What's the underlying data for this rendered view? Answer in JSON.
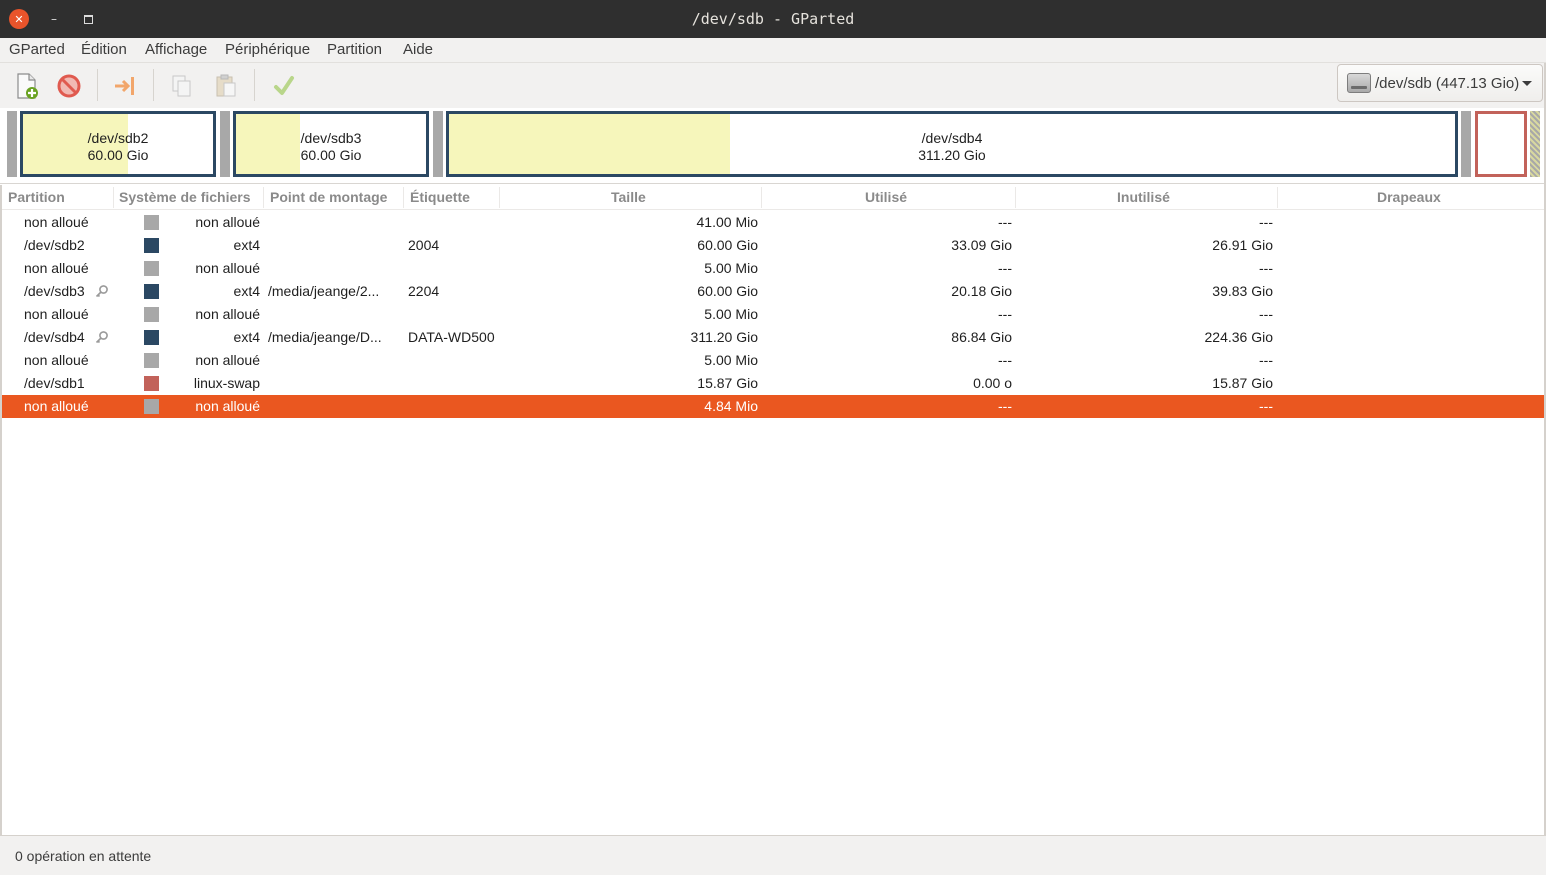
{
  "window": {
    "title": "/dev/sdb - GParted",
    "close_glyph": "✕",
    "minimize_glyph": "–"
  },
  "menu": [
    "GParted",
    "Édition",
    "Affichage",
    "Périphérique",
    "Partition",
    "Aide"
  ],
  "toolbar": {
    "buttons": [
      {
        "name": "new-partition-icon",
        "enabled": true
      },
      {
        "name": "delete-icon",
        "enabled": true
      },
      {
        "name": "resize-move-icon",
        "enabled": true
      },
      {
        "name": "copy-icon",
        "enabled": false
      },
      {
        "name": "paste-icon",
        "enabled": false
      },
      {
        "name": "apply-icon",
        "enabled": false
      }
    ],
    "device_selector": "/dev/sdb (447.13 Gio)"
  },
  "diskmap": {
    "partitions": [
      {
        "name": "/dev/sdb2",
        "size": "60.00 Gio",
        "used_fraction": 0.5515
      },
      {
        "name": "/dev/sdb3",
        "size": "60.00 Gio",
        "used_fraction": 0.3363
      },
      {
        "name": "/dev/sdb4",
        "size": "311.20 Gio",
        "used_fraction": 0.279
      },
      {
        "name": "/dev/sdb1",
        "size": "15.87 Gio",
        "used_fraction": 0.0
      }
    ]
  },
  "table": {
    "columns": [
      "Partition",
      "Système de fichiers",
      "Point de montage",
      "Étiquette",
      "Taille",
      "Utilisé",
      "Inutilisé",
      "Drapeaux"
    ],
    "rows": [
      {
        "partition": "non alloué",
        "fs": "non alloué",
        "fs_color": "#a8a8a8",
        "mount": "",
        "label": "",
        "size": "41.00 Mio",
        "used": "---",
        "unused": "---",
        "flags": "",
        "mounted": false
      },
      {
        "partition": "/dev/sdb2",
        "fs": "ext4",
        "fs_color": "#2b4863",
        "mount": "",
        "label": "2004",
        "size": "60.00 Gio",
        "used": "33.09 Gio",
        "unused": "26.91 Gio",
        "flags": "",
        "mounted": false
      },
      {
        "partition": "non alloué",
        "fs": "non alloué",
        "fs_color": "#a8a8a8",
        "mount": "",
        "label": "",
        "size": "5.00 Mio",
        "used": "---",
        "unused": "---",
        "flags": "",
        "mounted": false
      },
      {
        "partition": "/dev/sdb3",
        "fs": "ext4",
        "fs_color": "#2b4863",
        "mount": "/media/jeange/2...",
        "label": "2204",
        "size": "60.00 Gio",
        "used": "20.18 Gio",
        "unused": "39.83 Gio",
        "flags": "",
        "mounted": true
      },
      {
        "partition": "non alloué",
        "fs": "non alloué",
        "fs_color": "#a8a8a8",
        "mount": "",
        "label": "",
        "size": "5.00 Mio",
        "used": "---",
        "unused": "---",
        "flags": "",
        "mounted": false
      },
      {
        "partition": "/dev/sdb4",
        "fs": "ext4",
        "fs_color": "#2b4863",
        "mount": "/media/jeange/D...",
        "label": "DATA-WD500",
        "size": "311.20 Gio",
        "used": "86.84 Gio",
        "unused": "224.36 Gio",
        "flags": "",
        "mounted": true
      },
      {
        "partition": "non alloué",
        "fs": "non alloué",
        "fs_color": "#a8a8a8",
        "mount": "",
        "label": "",
        "size": "5.00 Mio",
        "used": "---",
        "unused": "---",
        "flags": "",
        "mounted": false
      },
      {
        "partition": "/dev/sdb1",
        "fs": "linux-swap",
        "fs_color": "#c2625a",
        "mount": "",
        "label": "",
        "size": "15.87 Gio",
        "used": "0.00 o",
        "unused": "15.87 Gio",
        "flags": "",
        "mounted": false
      },
      {
        "partition": "non alloué",
        "fs": "non alloué",
        "fs_color": "#a8a8a8",
        "mount": "",
        "label": "",
        "size": "4.84 Mio",
        "used": "---",
        "unused": "---",
        "flags": "",
        "mounted": false,
        "selected": true
      }
    ]
  },
  "status": "0 opération en attente",
  "colors": {
    "accent": "#ea5720",
    "ext4": "#2b4863",
    "swap": "#c2625a",
    "unallocated": "#a8a8a8",
    "used_fill": "#f6f6bb"
  }
}
